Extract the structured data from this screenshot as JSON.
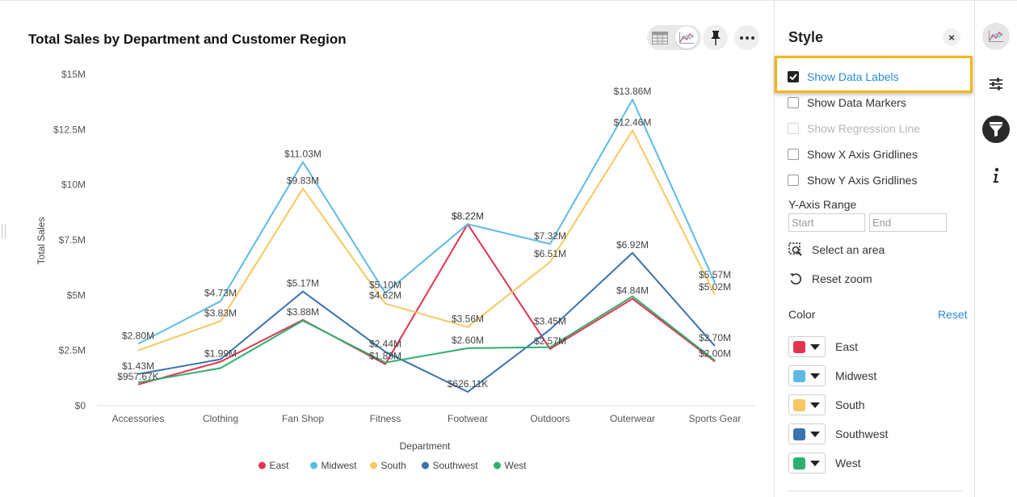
{
  "chart_data": {
    "type": "line",
    "title": "Total Sales by Department and Customer Region",
    "xlabel": "Department",
    "ylabel": "Total Sales",
    "categories": [
      "Accessories",
      "Clothing",
      "Fan Shop",
      "Fitness",
      "Footwear",
      "Outdoors",
      "Outerwear",
      "Sports Gear"
    ],
    "ylim": [
      0,
      15000000
    ],
    "yticks": [
      0,
      2500000,
      5000000,
      7500000,
      10000000,
      12500000,
      15000000
    ],
    "ytick_labels": [
      "$0",
      "$2.5M",
      "$5M",
      "$7.5M",
      "$10M",
      "$12.5M",
      "$15M"
    ],
    "grid": false,
    "legend_position": "bottom",
    "series": [
      {
        "name": "East",
        "color": "#e3344f",
        "values": [
          957670,
          1990000,
          3880000,
          1880000,
          8220000,
          2570000,
          4840000,
          2000000
        ],
        "labels": [
          "$957.67K",
          "$1.99M",
          "$3.88M",
          "$1.88M",
          "$8.22M",
          "$2.57M",
          "$4.84M",
          "$2.00M"
        ]
      },
      {
        "name": "Midwest",
        "color": "#5dbbe3",
        "values": [
          2800000,
          4730000,
          11030000,
          5100000,
          8220000,
          7320000,
          13860000,
          5570000
        ],
        "labels": [
          "$2.80M",
          "$4.73M",
          "$11.03M",
          "$5.10M",
          "$8.22M",
          "$7.32M",
          "$13.86M",
          "$5.57M"
        ]
      },
      {
        "name": "South",
        "color": "#f6c85f",
        "values": [
          2500000,
          3830000,
          9830000,
          4620000,
          3560000,
          6510000,
          12460000,
          5020000
        ],
        "labels": [
          "",
          "$3.83M",
          "$9.83M",
          "$4.62M",
          "$3.56M",
          "$6.51M",
          "$12.46M",
          "$5.02M"
        ]
      },
      {
        "name": "Southwest",
        "color": "#3a73ad",
        "values": [
          1430000,
          2100000,
          5170000,
          2440000,
          626110,
          3450000,
          6920000,
          2700000
        ],
        "labels": [
          "$1.43M",
          "",
          "$5.17M",
          "$2.44M",
          "$626.11K",
          "$3.45M",
          "$6.92M",
          "$2.70M"
        ]
      },
      {
        "name": "West",
        "color": "#2eb06d",
        "values": [
          1050000,
          1700000,
          3850000,
          1950000,
          2600000,
          2650000,
          4950000,
          2050000
        ],
        "labels": [
          "",
          "",
          "",
          "",
          "$2.60M",
          "",
          "",
          ""
        ]
      }
    ]
  },
  "style_panel": {
    "title": "Style",
    "close_glyph": "×",
    "options": [
      {
        "label": "Show Data Labels",
        "checked": true,
        "disabled": false,
        "highlighted": true
      },
      {
        "label": "Show Data Markers",
        "checked": false,
        "disabled": false
      },
      {
        "label": "Show Regression Line",
        "checked": false,
        "disabled": true
      },
      {
        "label": "Show X Axis Gridlines",
        "checked": false,
        "disabled": false
      },
      {
        "label": "Show Y Axis Gridlines",
        "checked": false,
        "disabled": false
      }
    ],
    "y_axis_range_label": "Y-Axis Range",
    "start_placeholder": "Start",
    "end_placeholder": "End",
    "select_area_label": "Select an area",
    "reset_zoom_label": "Reset zoom",
    "color_label": "Color",
    "color_reset_label": "Reset",
    "colors": [
      {
        "name": "East",
        "color": "#e3344f"
      },
      {
        "name": "Midwest",
        "color": "#5dbbe3"
      },
      {
        "name": "South",
        "color": "#f6c85f"
      },
      {
        "name": "Southwest",
        "color": "#3a73ad"
      },
      {
        "name": "West",
        "color": "#2eb06d"
      }
    ]
  },
  "toolbar": {
    "icons": [
      "table-icon",
      "line-chart-icon",
      "pin-icon",
      "more-icon"
    ]
  },
  "right_rail": {
    "icons": [
      "chart-type-icon",
      "settings-sliders-icon",
      "filter-icon",
      "info-icon"
    ]
  }
}
